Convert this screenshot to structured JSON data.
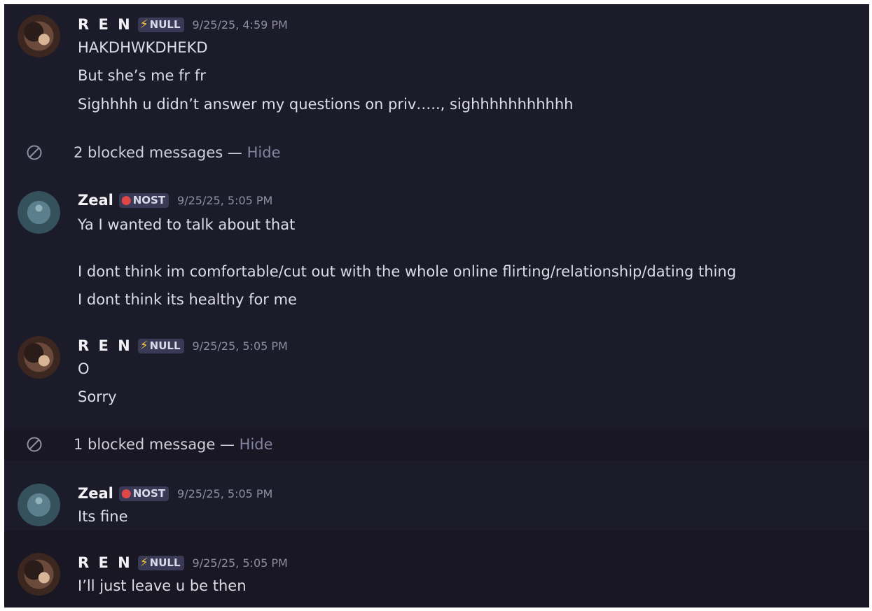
{
  "messages": [
    {
      "username": "R E N",
      "tag": {
        "icon": "lightning-bolt-icon",
        "label": "NULL"
      },
      "timestamp": "9/25/25, 4:59 PM",
      "lines": [
        "HAKDHWKDHEKD",
        "But she’s me fr fr",
        "Sighhhh u didn’t answer my questions on priv….., sighhhhhhhhhhh"
      ]
    },
    {
      "blocked": "2 blocked messages — ",
      "hide": "Hide"
    },
    {
      "username": "Zeal",
      "tag": {
        "icon": "flame-orb-icon",
        "label": "NOST"
      },
      "timestamp": "9/25/25, 5:05 PM",
      "lines": [
        "Ya I wanted to talk about that",
        "I dont think im comfortable/cut out with the whole online flirting/relationship/dating thing",
        "I dont think its healthy for me"
      ]
    },
    {
      "username": "R E N",
      "tag": {
        "icon": "lightning-bolt-icon",
        "label": "NULL"
      },
      "timestamp": "9/25/25, 5:05 PM",
      "lines": [
        "O",
        "Sorry"
      ]
    },
    {
      "blocked": "1 blocked message — ",
      "hide": "Hide"
    },
    {
      "username": "Zeal",
      "tag": {
        "icon": "flame-orb-icon",
        "label": "NOST"
      },
      "timestamp": "9/25/25, 5:05 PM",
      "lines": [
        "Its fine"
      ]
    },
    {
      "username": "R E N",
      "tag": {
        "icon": "lightning-bolt-icon",
        "label": "NULL"
      },
      "timestamp": "9/25/25, 5:05 PM",
      "lines": [
        "I’ll just leave u be then"
      ]
    }
  ],
  "colors": {
    "background": "#1c1b29",
    "alt_background": "#181723",
    "tag_background": "#3b3a56",
    "timestamp": "#8e8da2",
    "hide_link": "#8584a0"
  }
}
